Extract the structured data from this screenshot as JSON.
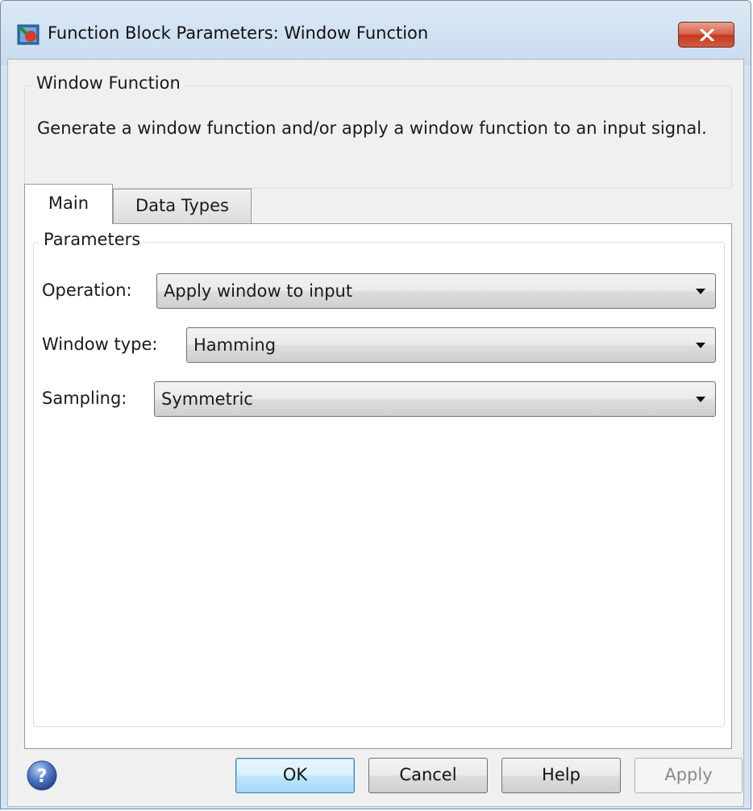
{
  "window": {
    "title": "Function Block Parameters: Window Function"
  },
  "description_group": {
    "legend": "Window Function",
    "text": "Generate a window function and/or apply a window function to an input signal."
  },
  "tabs": [
    {
      "label": "Main",
      "active": true
    },
    {
      "label": "Data Types",
      "active": false
    }
  ],
  "parameters_group": {
    "legend": "Parameters",
    "fields": [
      {
        "label": "Operation:",
        "value": "Apply window to input"
      },
      {
        "label": "Window type:",
        "value": "Hamming"
      },
      {
        "label": "Sampling:",
        "value": "Symmetric"
      }
    ]
  },
  "buttons": {
    "ok": "OK",
    "cancel": "Cancel",
    "help": "Help",
    "apply": "Apply",
    "apply_enabled": false
  },
  "icons": {
    "title_icon": "simulink-block-icon",
    "close_icon": "close-icon",
    "help_icon": "question-icon"
  },
  "colors": {
    "titlebar": "#c8dbee",
    "close_button": "#c2391f",
    "default_button_border": "#3c7fb1",
    "disabled_text": "#8a8a8a"
  }
}
